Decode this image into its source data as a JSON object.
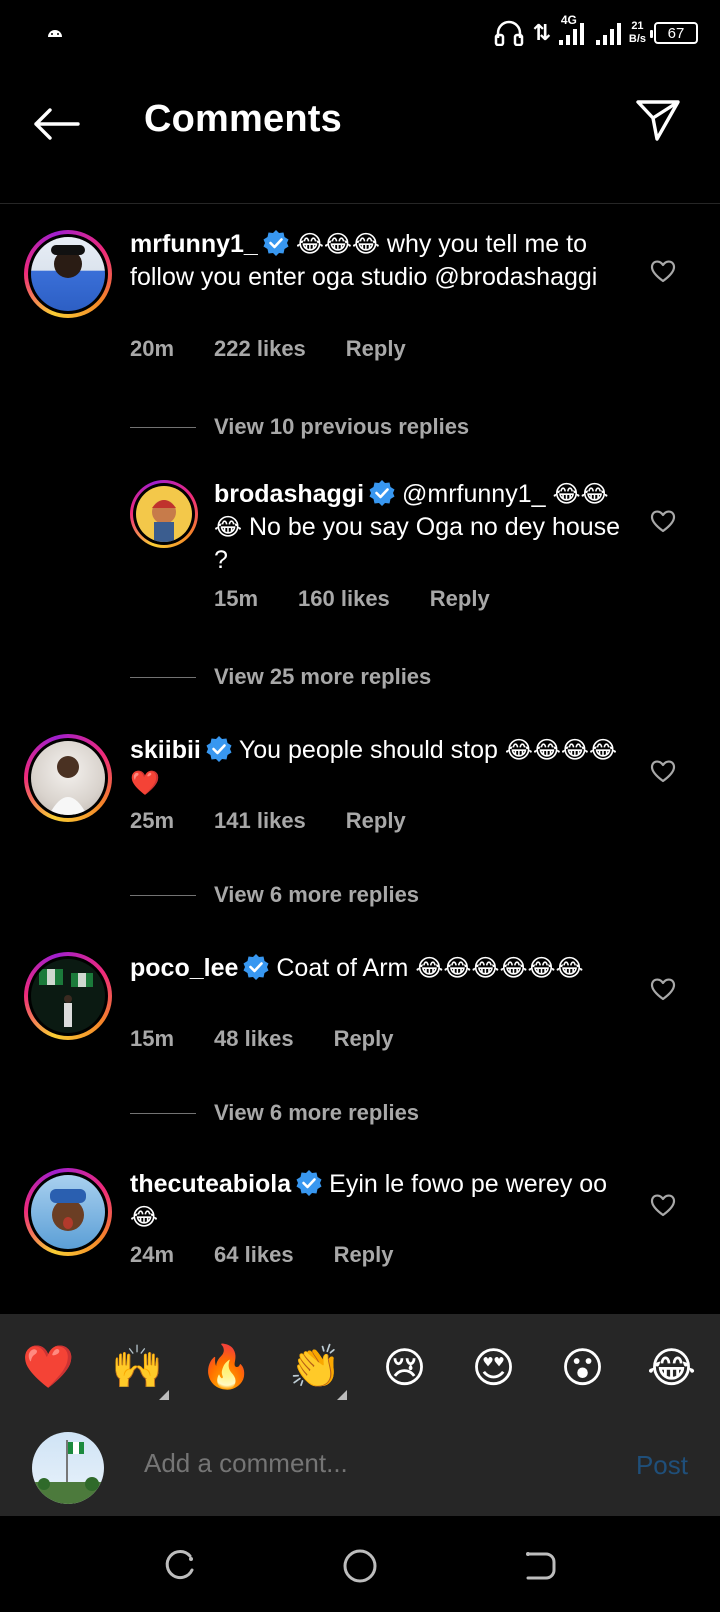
{
  "status_bar": {
    "network": "4G",
    "speed_value": "21",
    "speed_unit": "B/s",
    "battery": "67"
  },
  "header": {
    "title": "Comments"
  },
  "comments": [
    {
      "username": "mrfunny1_",
      "verified": true,
      "emoji": "😂😂😂",
      "text": " why you tell me to follow you enter oga studio @brodashaggi",
      "time": "20m",
      "likes": "222 likes",
      "reply": "Reply",
      "view_replies": "View 10 previous replies"
    },
    {
      "username": "brodashaggi",
      "verified": true,
      "text_a": "@mrfunny1_ ",
      "emoji": "😂😂😂",
      "text_b": " No be you say Oga no dey house ?",
      "time": "15m",
      "likes": "160 likes",
      "reply": "Reply",
      "view_replies": "View 25 more replies"
    },
    {
      "username": "skiibii",
      "verified": true,
      "text": "You people should stop ",
      "emoji": "😂😂😂😂❤️",
      "time": "25m",
      "likes": "141 likes",
      "reply": "Reply",
      "view_replies": "View 6 more replies"
    },
    {
      "username": "poco_lee",
      "verified": true,
      "text": "Coat of Arm ",
      "emoji": "😂😂😂😂😂😂",
      "time": "15m",
      "likes": "48 likes",
      "reply": "Reply",
      "view_replies": "View 6 more replies"
    },
    {
      "username": "thecuteabiola",
      "verified": true,
      "text": "Eyin le fowo pe werey oo ",
      "emoji": "😂",
      "time": "24m",
      "likes": "64 likes",
      "reply": "Reply"
    }
  ],
  "emoji_bar": [
    "❤️",
    "🙌",
    "🔥",
    "👏",
    "😢",
    "😍",
    "😮",
    "😂"
  ],
  "composer": {
    "placeholder": "Add a comment...",
    "post_label": "Post"
  },
  "colors": {
    "background": "#000000",
    "secondary_text": "#a8a8a8",
    "verified_blue": "#3897f0",
    "post_disabled": "#1f4f7a",
    "panel": "#262626"
  }
}
